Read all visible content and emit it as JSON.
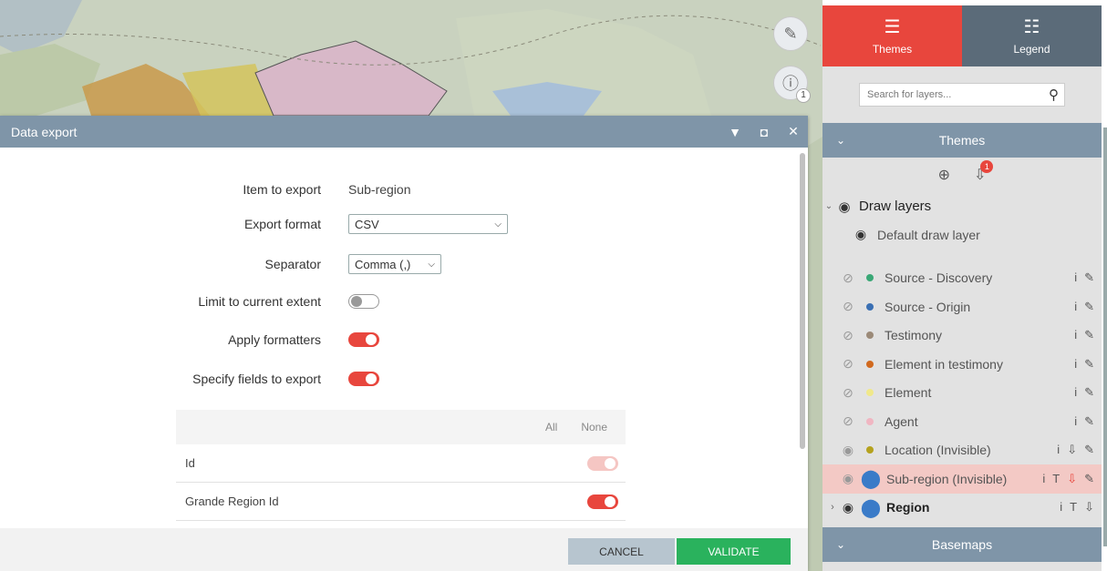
{
  "map": {
    "draw_tool_icon": "pencil-cross-icon",
    "info_tool_icon": "info-cursor-icon",
    "info_badge": "1",
    "colors": {
      "background": "#c9d2bf",
      "region_pink": "#d8b8c8",
      "region_yellow": "#d4c45c",
      "region_orange": "#c99a4a"
    }
  },
  "dialog": {
    "title": "Data export",
    "controls": {
      "collapse_icon": "caret-down-icon",
      "maximize_icon": "window-icon",
      "close_icon": "close-icon"
    },
    "fields": {
      "item": {
        "label": "Item to export",
        "value": "Sub-region"
      },
      "format": {
        "label": "Export format",
        "value": "CSV"
      },
      "separator": {
        "label": "Separator",
        "value": "Comma (,)"
      },
      "limit": {
        "label": "Limit to current extent",
        "enabled": false
      },
      "formatters": {
        "label": "Apply formatters",
        "enabled": true
      },
      "specify": {
        "label": "Specify fields to export",
        "enabled": true
      }
    },
    "field_table": {
      "all_label": "All",
      "none_label": "None",
      "rows": [
        {
          "name": "Id",
          "enabled": true,
          "disabled": true
        },
        {
          "name": "Grande Region Id",
          "enabled": true,
          "disabled": false
        }
      ]
    },
    "buttons": {
      "cancel": "CANCEL",
      "validate": "VALIDATE"
    }
  },
  "panel": {
    "tabs": [
      {
        "label": "Themes",
        "icon": "list-icon",
        "active": true
      },
      {
        "label": "Legend",
        "icon": "legend-icon",
        "active": false
      }
    ],
    "search": {
      "placeholder": "Search for layers..."
    },
    "themes_header": "Themes",
    "tools": {
      "zoom_icon": "zoom-layer-icon",
      "filter_icon": "filter-icon",
      "filter_badge": "1"
    },
    "draw_group": {
      "label": "Draw layers",
      "default_layer": "Default draw layer"
    },
    "layers": [
      {
        "name": "Source - Discovery",
        "color": "#3aa876"
      },
      {
        "name": "Source - Origin",
        "color": "#3a6fb3"
      },
      {
        "name": "Testimony",
        "color": "#9b8a78"
      },
      {
        "name": "Element in testimony",
        "color": "#d1691e"
      },
      {
        "name": "Element",
        "color": "#f0e88a"
      },
      {
        "name": "Agent",
        "color": "#f0b6c2"
      },
      {
        "name": "Location (Invisible)",
        "color": "#b5a21e"
      }
    ],
    "subregion": {
      "name": "Sub-region (Invisible)",
      "info": "i",
      "text_icon": "T"
    },
    "region": {
      "name": "Region",
      "info": "i",
      "text_icon": "T"
    },
    "basemaps_header": "Basemaps",
    "colors": {
      "accent": "#e8463d",
      "header": "#7f95a8",
      "legend_tab": "#5b6b79"
    }
  }
}
